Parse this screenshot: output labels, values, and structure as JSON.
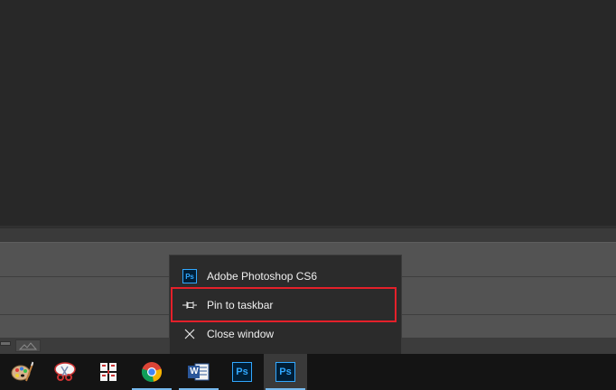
{
  "jumplist": {
    "app_title": "Adobe Photoshop CS6",
    "pin_label": "Pin to taskbar",
    "close_label": "Close window",
    "app_icon_text": "Ps"
  },
  "taskbar": {
    "items": [
      {
        "name": "paint-palette-app",
        "icon": "palette-icon"
      },
      {
        "name": "snipping-tool-app",
        "icon": "scissors-icon"
      },
      {
        "name": "calculator-like-app",
        "icon": "grid-app-icon"
      },
      {
        "name": "chrome-app",
        "icon": "chrome-icon"
      },
      {
        "name": "word-app",
        "icon": "word-icon",
        "icon_text": "W"
      },
      {
        "name": "photoshop-app",
        "icon": "photoshop-icon",
        "icon_text": "Ps"
      },
      {
        "name": "photoshop-app-active",
        "icon": "photoshop-icon",
        "icon_text": "Ps"
      }
    ]
  },
  "colors": {
    "highlight": "#e4202a",
    "taskbar": "#141414",
    "accent_underline": "#76b9ed",
    "photoshop_blue": "#31a8ff"
  }
}
